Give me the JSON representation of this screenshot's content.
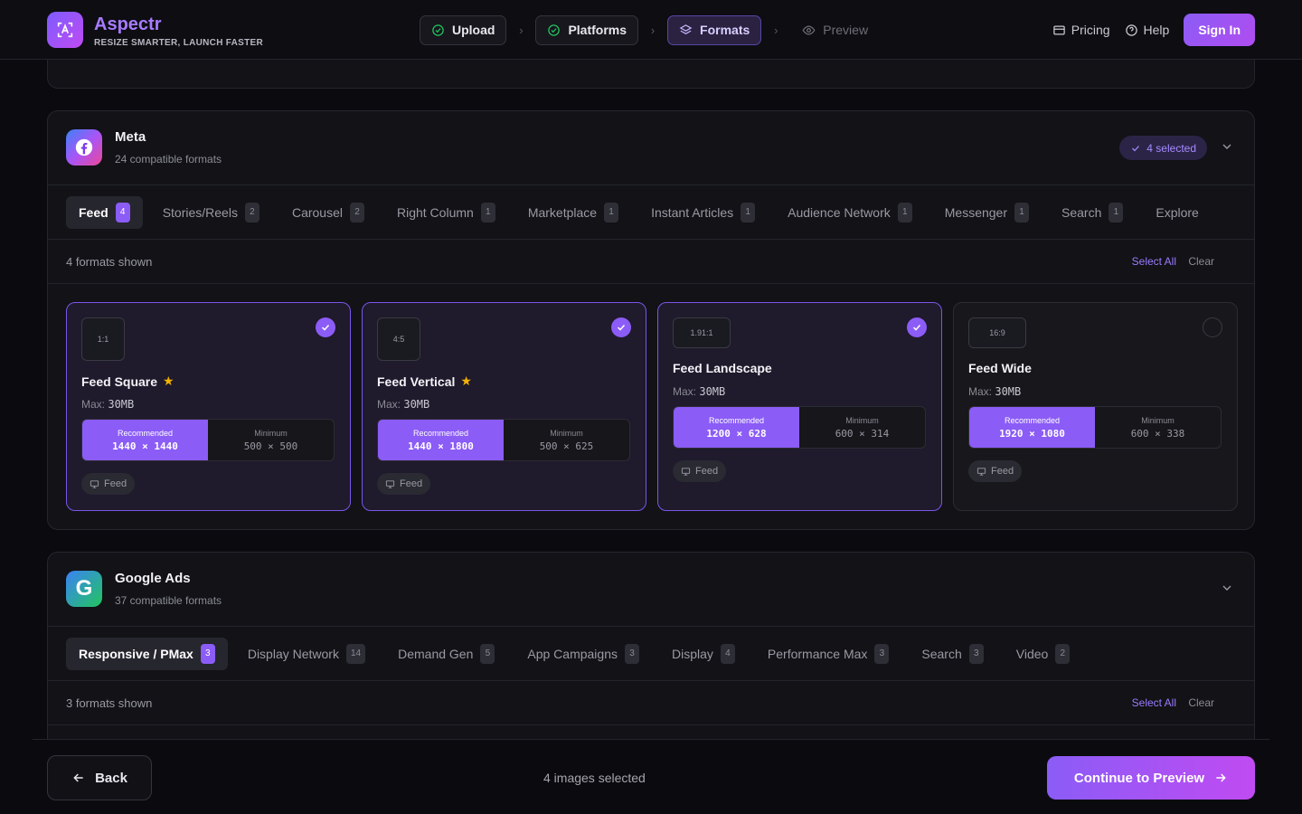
{
  "app": {
    "name": "Aspectr",
    "tagline": "RESIZE SMARTER, LAUNCH FASTER",
    "accent": "#8b5cf6"
  },
  "steps": [
    {
      "label": "Upload",
      "state": "done"
    },
    {
      "label": "Platforms",
      "state": "done"
    },
    {
      "label": "Formats",
      "state": "active"
    },
    {
      "label": "Preview",
      "state": "disabled"
    }
  ],
  "nav": {
    "pricing": "Pricing",
    "help": "Help",
    "sign_in": "Sign In"
  },
  "meta": {
    "title": "Meta",
    "subtitle": "24 compatible formats",
    "selected_badge": "4 selected",
    "tabs": [
      {
        "label": "Feed",
        "count": "4"
      },
      {
        "label": "Stories/Reels",
        "count": "2"
      },
      {
        "label": "Carousel",
        "count": "2"
      },
      {
        "label": "Right Column",
        "count": "1"
      },
      {
        "label": "Marketplace",
        "count": "1"
      },
      {
        "label": "Instant Articles",
        "count": "1"
      },
      {
        "label": "Audience Network",
        "count": "1"
      },
      {
        "label": "Messenger",
        "count": "1"
      },
      {
        "label": "Search",
        "count": "1"
      },
      {
        "label": "Explore",
        "count": ""
      }
    ],
    "shown": "4 formats shown",
    "select_all": "Select All",
    "clear": "Clear",
    "formats": [
      {
        "ratio": "1:1",
        "name": "Feed Square",
        "max_label": "Max:",
        "max": "30MB",
        "rec_label": "Recommended",
        "rec": "1440 × 1440",
        "min_label": "Minimum",
        "min": "500 × 500",
        "tag": "Feed",
        "selected": true,
        "starred": true
      },
      {
        "ratio": "4:5",
        "name": "Feed Vertical",
        "max_label": "Max:",
        "max": "30MB",
        "rec_label": "Recommended",
        "rec": "1440 × 1800",
        "min_label": "Minimum",
        "min": "500 × 625",
        "tag": "Feed",
        "selected": true,
        "starred": true
      },
      {
        "ratio": "1.91:1",
        "name": "Feed Landscape",
        "max_label": "Max:",
        "max": "30MB",
        "rec_label": "Recommended",
        "rec": "1200 × 628",
        "min_label": "Minimum",
        "min": "600 × 314",
        "tag": "Feed",
        "selected": true,
        "starred": false
      },
      {
        "ratio": "16:9",
        "name": "Feed Wide",
        "max_label": "Max:",
        "max": "30MB",
        "rec_label": "Recommended",
        "rec": "1920 × 1080",
        "min_label": "Minimum",
        "min": "600 × 338",
        "tag": "Feed",
        "selected": false,
        "starred": false
      }
    ]
  },
  "google": {
    "title": "Google Ads",
    "subtitle": "37 compatible formats",
    "tabs": [
      {
        "label": "Responsive / PMax",
        "count": "3"
      },
      {
        "label": "Display Network",
        "count": "14"
      },
      {
        "label": "Demand Gen",
        "count": "5"
      },
      {
        "label": "App Campaigns",
        "count": "3"
      },
      {
        "label": "Display",
        "count": "4"
      },
      {
        "label": "Performance Max",
        "count": "3"
      },
      {
        "label": "Search",
        "count": "3"
      },
      {
        "label": "Video",
        "count": "2"
      }
    ],
    "shown": "3 formats shown",
    "select_all": "Select All",
    "clear": "Clear"
  },
  "footer": {
    "back": "Back",
    "count": "4 images selected",
    "continue": "Continue to Preview"
  }
}
